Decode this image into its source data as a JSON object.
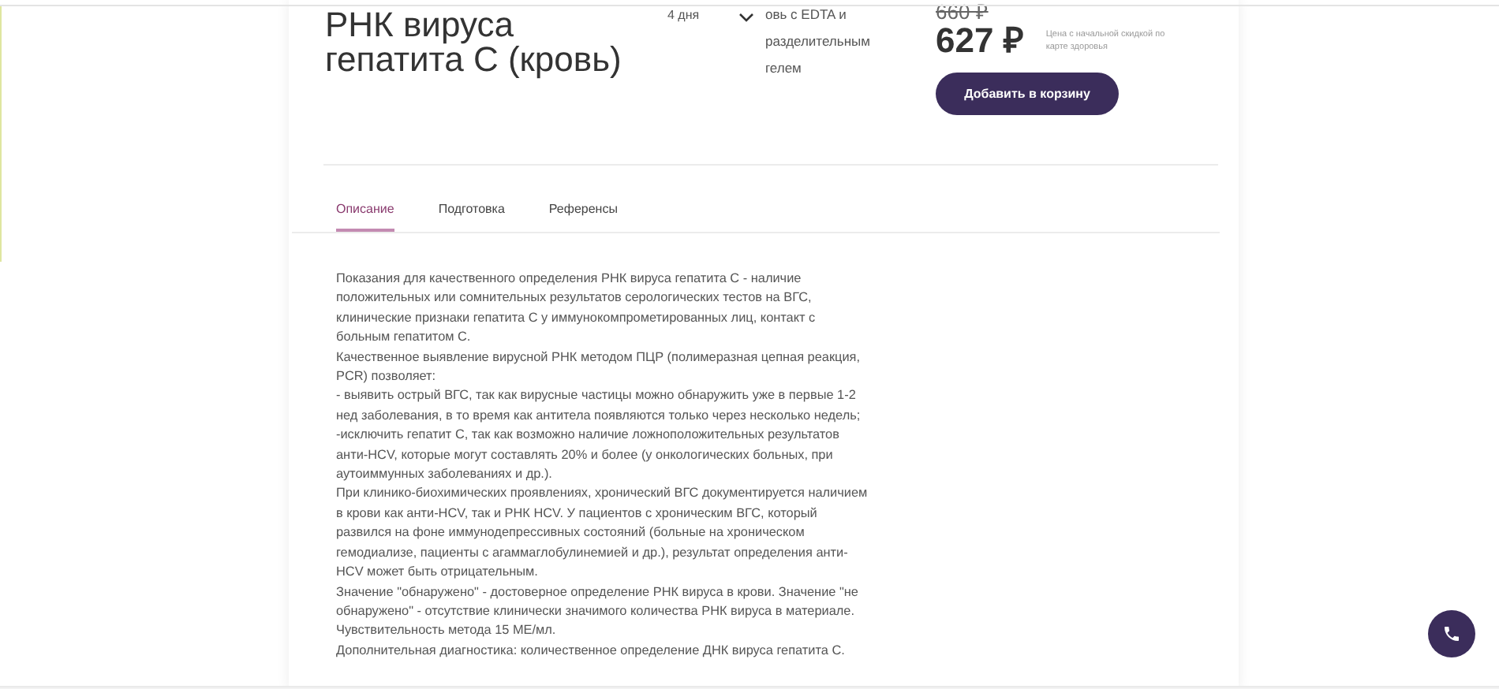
{
  "product": {
    "title": "РНК вируса гепатита С (кровь)",
    "duration": "4 дня",
    "biomaterial": "овь с EDTA и разделительным гелем",
    "biomaterial_expanded": false
  },
  "price": {
    "old": "660 ₽",
    "current": "627 ₽",
    "note": "Цена с начальной скидкой по карте здоровья",
    "button": "Добавить в корзину"
  },
  "tabs": [
    {
      "label": "Описание",
      "selected": true
    },
    {
      "label": "Подготовка",
      "selected": false
    },
    {
      "label": "Референсы",
      "selected": false
    }
  ],
  "description": [
    "Показания для качественного определения РНК вируса гепатита С - наличие положительных или сомнительных результатов серологических тестов на ВГС, клинические признаки гепатита С у иммунокомпрометированных лиц, контакт с больным гепатитом С.",
    "Качественное выявление вирусной РНК методом ПЦР (полимеразная цепная реакция, PCR) позволяет:",
    "- выявить острый ВГС, так как вирусные частицы можно обнаружить уже в первые 1-2 нед заболевания, в то время как антитела появляются только через несколько недель;",
    "-исключить гепатит С, так как возможно наличие ложноположительных результатов анти-HCV, которые могут составлять 20% и более (у онкологических больных, при аутоиммунных заболеваниях и др.).",
    "При клинико-биохимических проявлениях, хронический ВГС документируется наличием в крови как анти-HCV, так и РНК HCV. У пациентов с хроническим ВГС, который развился на фоне иммунодепрессивных состояний (больные на хроническом гемодиализе, пациенты с агаммаглобулинемией и др.), результат определения анти-HCV может быть отрицательным.",
    "Значение \"обнаружено\" - достоверное определение РНК вируса в крови. Значение \"не обнаружено\" - отсутствие клинически значимого количества РНК вируса в материале. Чувствительность метода 15 МЕ/мл.",
    "Дополнительная диагностика: количественное определение ДНК вируса гепатита С."
  ]
}
